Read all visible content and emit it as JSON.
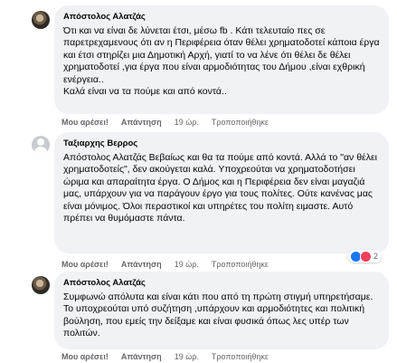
{
  "comments": [
    {
      "author": "Απόστολος Αλατζάς",
      "text": "Ότι και να είναι δε λύνεται έτσι, μέσω fb . Κάτι τελευταίο πες σε παρετρεχαμενους ότι αν η Περιφέρεια όταν θέλει χρηματοδοτεί κάποια έργα και έτσι στηρίζει μια Δημοτική Αρχή, γιατί το να λένε ότι θέλει δε θέλει χρηματοδοτεί ,για έργα που είναι αρμοδιότητας του Δήμου ,είναι εχθρική ενέργεια..\nΚαλά είναι να τα πούμε και από κοντά..",
      "like": "Μου αρέσει!",
      "reply": "Απάντηση",
      "time": "19 ώρ.",
      "edited": "Τροποποιήθηκε"
    },
    {
      "author": "Ταξιαρχης Βερρος",
      "text": "Απόστολος Αλατζάς Βεβαίως και θα τα πούμε από κοντά. Αλλά το \"αν θέλει χρηματοδοτείς\", δεν ακούγεται καλά. Υποχρεούται να χρηματοδοτήσει ώριμα και απαραίτητα έργα. Ο Δήμος και η Περιφέρεια δεν είναι μαγαζιά μας, υπάρχουν για να παράγουν έργο για τους πολίτες. Ούτε κανένας μας είναι μόνιμος. Όλοι περαστικοί και υπηρέτες του πολίτη ειμαστε. Αυτό πρέπει να θυμόμαστε πάντα.",
      "like": "Μου αρέσει!",
      "reply": "Απάντηση",
      "time": "19 ώρ.",
      "edited": "Τροποποιήθηκε",
      "reactions": {
        "count": "2",
        "types": [
          "like",
          "love"
        ]
      }
    },
    {
      "author": "Απόστολος Αλατζάς",
      "text": "Συμφωνώ απόλυτα και είναι κάτι που από τη πρώτη στιγμή υπηρετήσαμε. Το υποχρεούται υπό συζήτηση ,υπάρχουν και αρμοδιότητες και πολιτική βούληση, που εμείς την δείξαμε και είναι φυσικά όπως λες υπέρ των πολιτών.",
      "like": "Μου αρέσει!",
      "reply": "Απάντηση",
      "time": "19 ώρ.",
      "edited": "Τροποποιήθηκε"
    }
  ]
}
